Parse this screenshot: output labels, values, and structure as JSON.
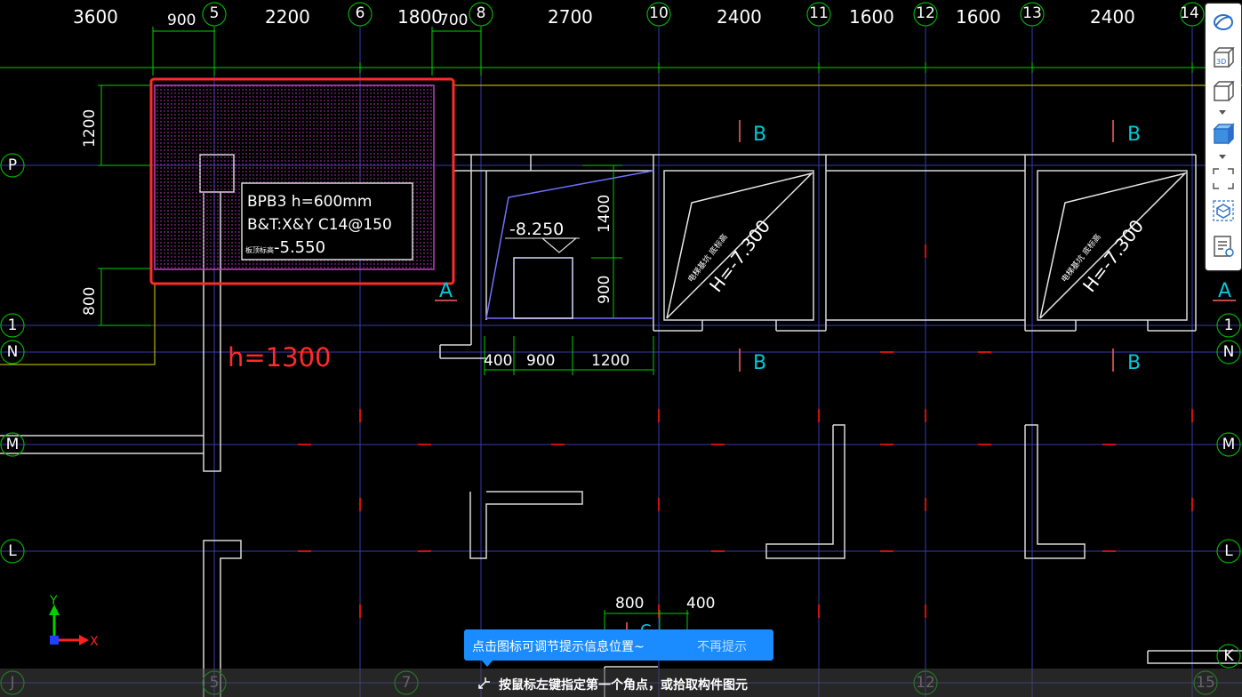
{
  "top_dimensions": [
    "3600",
    "900",
    "2200",
    "1800",
    "700",
    "2700",
    "2400",
    "1600",
    "1600",
    "2400"
  ],
  "top_axis_labels": [
    "5",
    "6",
    "8",
    "10",
    "11",
    "12",
    "13",
    "14"
  ],
  "left_axis_labels": [
    "P",
    "1",
    "N",
    "M",
    "L",
    "J"
  ],
  "right_axis_labels": [
    "1",
    "N",
    "M",
    "L",
    "K"
  ],
  "bottom_axis_labels": [
    "5",
    "7",
    "12",
    "15"
  ],
  "left_dimensions": [
    "1200",
    "800"
  ],
  "slab_tag": {
    "line1": "BPB3 h=600mm",
    "line2": "B&T:X&Y C14@150",
    "line3": "-5.550",
    "line3_prefix": "板顶标高"
  },
  "section_marks": [
    "A",
    "A",
    "B",
    "B",
    "B",
    "B"
  ],
  "elevations": {
    "pit": "-8.250",
    "pit_right": "1400",
    "pit_right2": "900",
    "well1": "H=-7.300",
    "well2": "H=-7.300",
    "well_note": "电梯基坑 底标高"
  },
  "pit_dimensions": [
    "400",
    "900",
    "1200"
  ],
  "bottom_dimensions": [
    "800",
    "400"
  ],
  "bottom_mark": "C",
  "annotation": "h=1300",
  "coord_axes": {
    "y": "Y",
    "x": "X"
  },
  "toolbar": {
    "items": [
      "orbit-icon",
      "3d-view-icon",
      "box-view-icon",
      "solid-view-icon",
      "select-region-icon",
      "component-select-icon",
      "properties-icon"
    ]
  },
  "tip": {
    "message": "点击图标可调节提示信息位置~",
    "dismiss": "不再提示"
  },
  "status": {
    "prompt": "按鼠标左键指定第一个角点，或拾取构件图元"
  },
  "colors": {
    "background": "#000000",
    "highlight_box": "#ff2a2a",
    "slab_border": "#c040c0",
    "axis_circle": "#00c000",
    "dimension_line": "#00ff00",
    "grid_line": "#3a3ab0",
    "tip_bg": "#1a8cff"
  }
}
